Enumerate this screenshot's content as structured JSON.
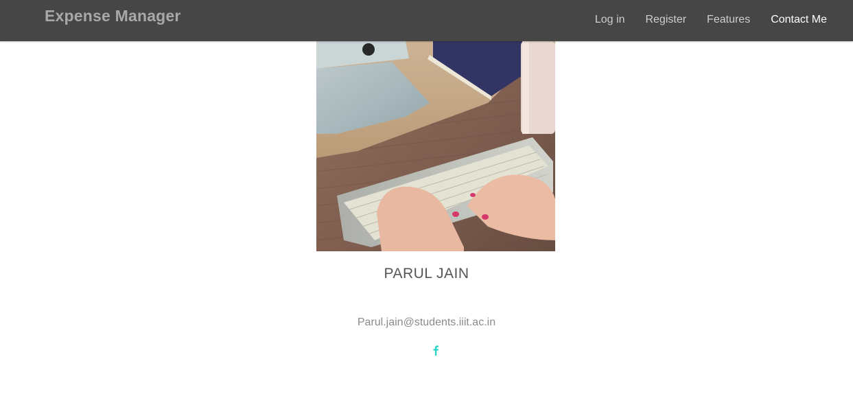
{
  "navbar": {
    "brand": "Expense Manager",
    "links": [
      {
        "label": "Log in"
      },
      {
        "label": "Register"
      },
      {
        "label": "Features"
      },
      {
        "label": "Contact Me"
      }
    ],
    "active_link": "Contact Me"
  },
  "profile": {
    "name": "PARUL JAIN",
    "email": "Parul.jain@students.iiit.ac.in",
    "social_icon": "facebook-icon"
  },
  "colors": {
    "navbar_bg": "#464646",
    "accent": "#2cd3c4"
  }
}
